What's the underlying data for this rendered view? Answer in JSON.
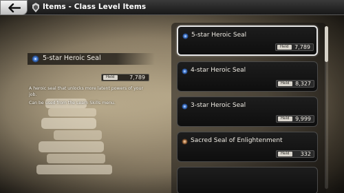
{
  "header": {
    "title": "Items - Class Level Items",
    "back_icon": "arrow-left-icon"
  },
  "detail": {
    "name": "5-star Heroic Seal",
    "held_label": "Held",
    "held_value": "7,789",
    "description_line1": "A heroic seal that unlocks more latent powers of your",
    "description_line2": "job.",
    "description_line3": "Can be used from the Learn Skills menu."
  },
  "items": [
    {
      "name": "5-star Heroic Seal",
      "held_label": "Held",
      "held_value": "7,789",
      "icon": "blue-seal-icon"
    },
    {
      "name": "4-star Heroic Seal",
      "held_label": "Held",
      "held_value": "8,327",
      "icon": "blue-seal-icon"
    },
    {
      "name": "3-star Heroic Seal",
      "held_label": "Held",
      "held_value": "9,999",
      "icon": "blue-seal-icon"
    },
    {
      "name": "Sacred Seal of Enlightenment",
      "held_label": "Held",
      "held_value": "332",
      "icon": "bronze-seal-icon"
    }
  ],
  "colors": {
    "seal_blue": "#4f86d9",
    "seal_bronze": "#c08a5a",
    "selected_border": "#e6e6e6"
  }
}
